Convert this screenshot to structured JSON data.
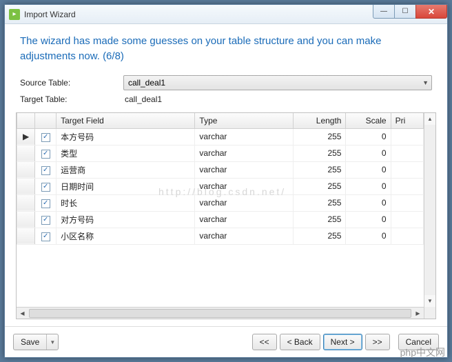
{
  "window": {
    "title": "Import Wizard"
  },
  "heading": "The wizard has made some guesses on your table structure and you can make adjustments now. (6/8)",
  "form": {
    "source_label": "Source Table:",
    "source_value": "call_deal1",
    "target_label": "Target Table:",
    "target_value": "call_deal1"
  },
  "grid": {
    "headers": {
      "target_field": "Target Field",
      "type": "Type",
      "length": "Length",
      "scale": "Scale",
      "primary": "Pri"
    },
    "rows": [
      {
        "active": true,
        "field": "本方号码",
        "type": "varchar",
        "length": "255",
        "scale": "0"
      },
      {
        "active": false,
        "field": "类型",
        "type": "varchar",
        "length": "255",
        "scale": "0"
      },
      {
        "active": false,
        "field": "运营商",
        "type": "varchar",
        "length": "255",
        "scale": "0"
      },
      {
        "active": false,
        "field": "日期时间",
        "type": "varchar",
        "length": "255",
        "scale": "0"
      },
      {
        "active": false,
        "field": "时长",
        "type": "varchar",
        "length": "255",
        "scale": "0"
      },
      {
        "active": false,
        "field": "对方号码",
        "type": "varchar",
        "length": "255",
        "scale": "0"
      },
      {
        "active": false,
        "field": "小区名称",
        "type": "varchar",
        "length": "255",
        "scale": "0"
      }
    ]
  },
  "footer": {
    "save": "Save",
    "first": "<<",
    "back": "< Back",
    "next": "Next >",
    "last": ">>",
    "cancel": "Cancel"
  },
  "watermark_mid": "http://blog.csdn.net/",
  "watermark_corner": "php中文网"
}
